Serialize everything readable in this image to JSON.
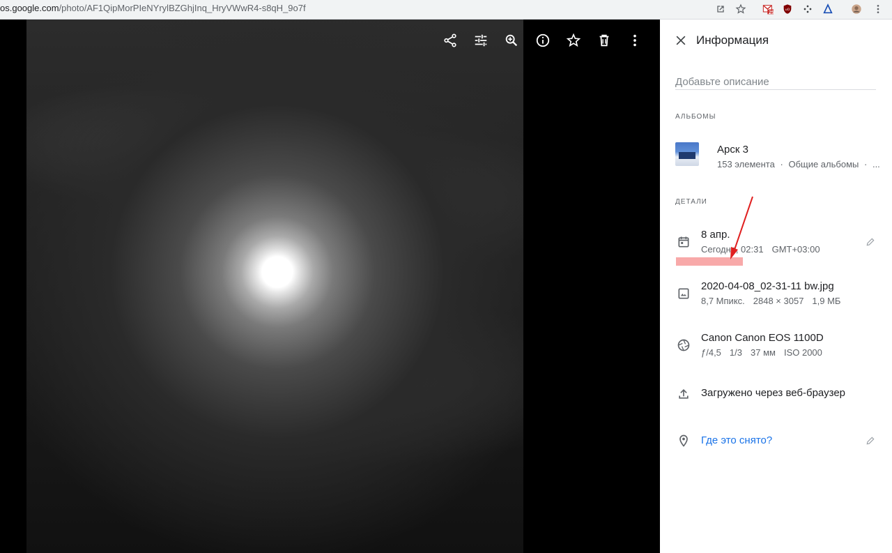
{
  "browser": {
    "url_host": "os.google.com",
    "url_path": "/photo/AF1QipMorPIeNYrylBZGhjInq_HryVWwR4-s8qH_9o7f",
    "gmail_badge": "25"
  },
  "viewer": {
    "toolbar": [
      "share-icon",
      "edit-adjust-icon",
      "zoom-icon",
      "info-icon",
      "star-icon",
      "delete-icon",
      "more-icon"
    ]
  },
  "info_panel": {
    "title": "Информация",
    "description_placeholder": "Добавьте описание",
    "albums_label": "АЛЬБОМЫ",
    "album": {
      "name": "Арск 3",
      "count": "153 элемента",
      "sep": "·",
      "type": "Общие альбомы",
      "more": "..."
    },
    "details_label": "ДЕТАЛИ",
    "date": {
      "date": "8 апр.",
      "time": "Сегодня, 02:31",
      "timezone": "GMT+03:00"
    },
    "file": {
      "name": "2020-04-08_02-31-11 bw.jpg",
      "megapixels": "8,7 Мпикс.",
      "resolution": "2848 × 3057",
      "size": "1,9 МБ"
    },
    "camera": {
      "model": "Canon Canon EOS 1100D",
      "aperture": "ƒ/4,5",
      "exposure": "1/3",
      "focal": "37 мм",
      "iso": "ISO 2000"
    },
    "upload": "Загружено через веб-браузер",
    "location_link": "Где это снято?"
  },
  "colors": {
    "link": "#1a73e8",
    "highlight": "#f8a9a9",
    "annotation_arrow": "#e02020"
  }
}
